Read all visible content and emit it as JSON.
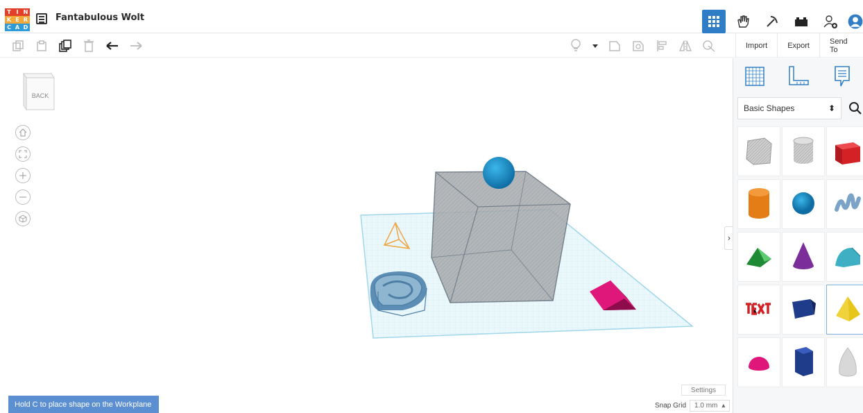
{
  "app": {
    "logo_letters": [
      "T",
      "I",
      "N",
      "K",
      "E",
      "R",
      "C",
      "A",
      "D"
    ],
    "logo_colors": [
      "#e2402b",
      "#e2402b",
      "#e2402b",
      "#f5a83a",
      "#f5a83a",
      "#f5a83a",
      "#2e9ad8",
      "#2e9ad8",
      "#2e9ad8"
    ],
    "doc_title": "Fantabulous Wolt"
  },
  "top_right": {
    "icons": [
      "grid-view-icon",
      "hands-icon",
      "pickaxe-icon",
      "bricks-icon",
      "add-user-icon",
      "user-avatar-icon"
    ],
    "accent": "#2e7dc6"
  },
  "toolbar": {
    "left_icons": [
      "copy-icon",
      "paste-icon",
      "duplicate-icon",
      "delete-icon",
      "undo-icon",
      "redo-icon"
    ],
    "mid_icons": [
      "light-bulb-icon",
      "dropdown-icon",
      "solid-icon",
      "hole-icon",
      "align-icon",
      "mirror-icon",
      "group-icon"
    ],
    "import_label": "Import",
    "export_label": "Export",
    "sendto_label": "Send To"
  },
  "view": {
    "cube_face": "BACK",
    "nav_icons": [
      "home-icon",
      "fit-view-icon",
      "zoom-in-icon",
      "zoom-out-icon",
      "ortho-icon"
    ]
  },
  "panel": {
    "tabs": [
      "workplane-icon",
      "ruler-icon",
      "notes-icon"
    ],
    "category": "Basic Shapes",
    "shapes": [
      {
        "name": "box-hole",
        "color": "#bfbfbf"
      },
      {
        "name": "cylinder-hole",
        "color": "#bfbfbf"
      },
      {
        "name": "box",
        "color": "#d42126"
      },
      {
        "name": "cylinder",
        "color": "#e57d16"
      },
      {
        "name": "sphere",
        "color": "#1f8ac2"
      },
      {
        "name": "scribble",
        "color": "#7aa3c7"
      },
      {
        "name": "roof",
        "color": "#28a744"
      },
      {
        "name": "cone",
        "color": "#7b2d99"
      },
      {
        "name": "round-roof",
        "color": "#3fb0c4"
      },
      {
        "name": "text",
        "color": "#d42126"
      },
      {
        "name": "wedge",
        "color": "#1f3c8a"
      },
      {
        "name": "pyramid",
        "color": "#e8c51a"
      },
      {
        "name": "half-sphere",
        "color": "#e0177b"
      },
      {
        "name": "polygon",
        "color": "#1f3c8a"
      },
      {
        "name": "paraboloid",
        "color": "#d8d8d8"
      }
    ]
  },
  "bottom": {
    "hint": "Hold C to place shape on the Workplane",
    "settings_label": "Settings",
    "snap_label": "Snap Grid",
    "snap_value": "1.0 mm"
  }
}
